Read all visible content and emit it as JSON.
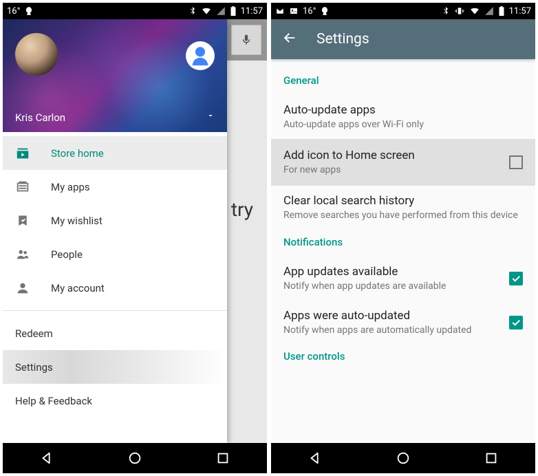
{
  "status": {
    "temp": "16°",
    "time": "11:57"
  },
  "drawer": {
    "user_name": "Kris Carlon",
    "items": [
      {
        "label": "Store home"
      },
      {
        "label": "My apps"
      },
      {
        "label": "My wishlist"
      },
      {
        "label": "People"
      },
      {
        "label": "My account"
      }
    ],
    "secondary": {
      "redeem": "Redeem",
      "settings": "Settings",
      "help": "Help & Feedback"
    }
  },
  "background_text": "try",
  "settings": {
    "title": "Settings",
    "sections": {
      "general": {
        "header": "General",
        "auto_update": {
          "title": "Auto-update apps",
          "sub": "Auto-update apps over Wi-Fi only"
        },
        "add_icon": {
          "title": "Add icon to Home screen",
          "sub": "For new apps",
          "checked": false
        },
        "clear_history": {
          "title": "Clear local search history",
          "sub": "Remove searches you have performed from this device"
        }
      },
      "notifications": {
        "header": "Notifications",
        "updates_available": {
          "title": "App updates available",
          "sub": "Notify when app updates are available",
          "checked": true
        },
        "auto_updated": {
          "title": "Apps were auto-updated",
          "sub": "Notify when apps are automatically updated",
          "checked": true
        }
      },
      "user_controls": {
        "header": "User controls"
      }
    }
  }
}
